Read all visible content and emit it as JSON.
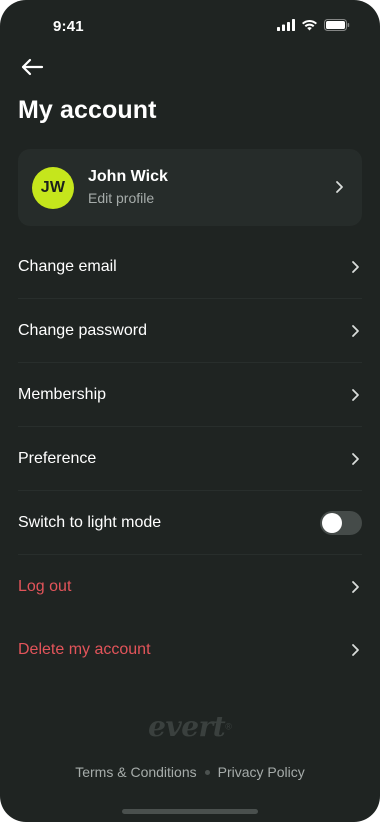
{
  "status_bar": {
    "time": "9:41"
  },
  "header": {
    "title": "My account"
  },
  "profile": {
    "initials": "JW",
    "name": "John Wick",
    "subtitle": "Edit profile",
    "avatar_color": "#c5e61c"
  },
  "menu": {
    "items": [
      {
        "label": "Change email"
      },
      {
        "label": "Change password"
      },
      {
        "label": "Membership"
      },
      {
        "label": "Preference"
      },
      {
        "label": "Switch to light mode",
        "toggle_on": false
      },
      {
        "label": "Log out"
      },
      {
        "label": "Delete my account"
      }
    ],
    "danger_color": "#e2545a"
  },
  "footer": {
    "brand": "evert",
    "brand_mark": "®",
    "terms": "Terms & Conditions",
    "privacy": "Privacy Policy"
  },
  "icons": {
    "back": "arrow-left-icon",
    "chevron": "chevron-right-icon",
    "signal": "signal-icon",
    "wifi": "wifi-icon",
    "battery": "battery-icon"
  },
  "colors": {
    "background": "#1f2422",
    "card": "#262c2a"
  }
}
